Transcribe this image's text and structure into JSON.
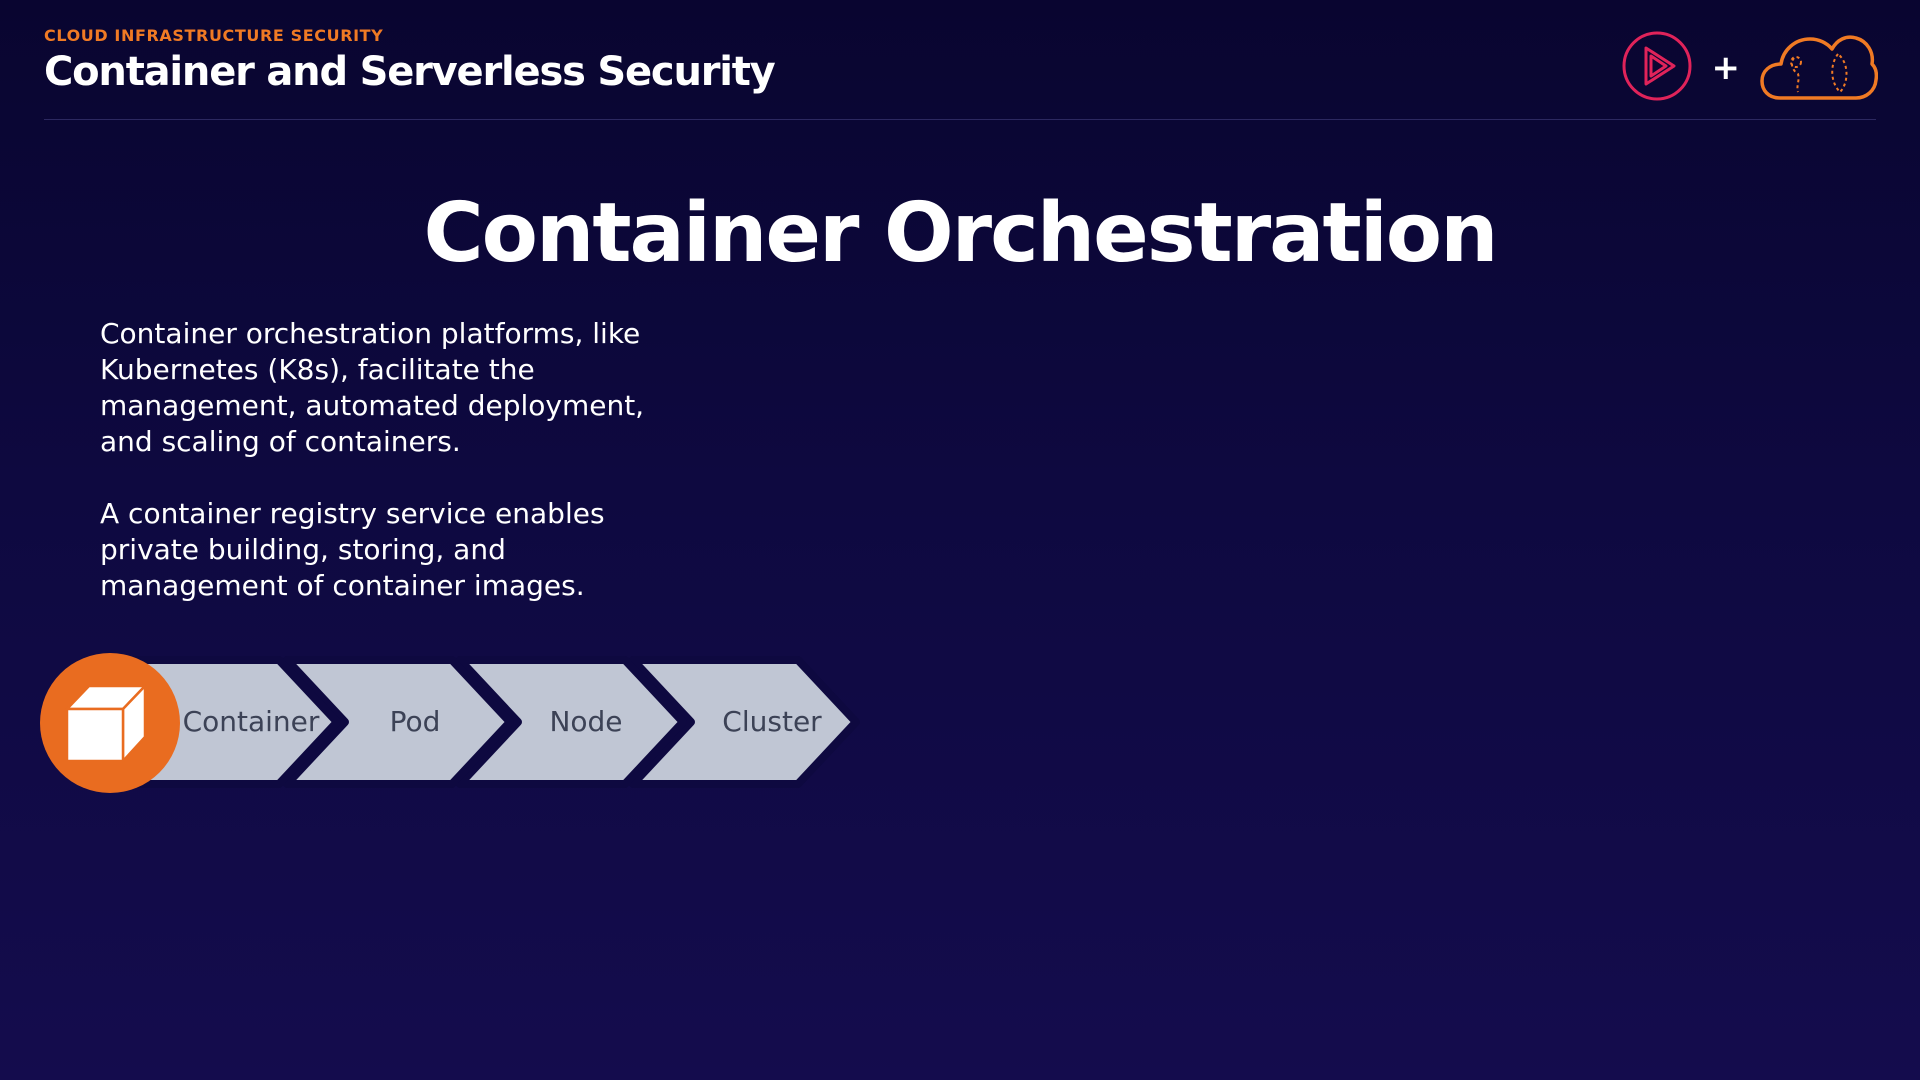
{
  "header": {
    "course_label": "CLOUD INFRASTRUCTURE SECURITY",
    "module_title": "Container and Serverless Security",
    "brand": {
      "play_logo_icon": "play-logo-icon",
      "plus": "+",
      "cloud_logo_icon": "cloud-logo-icon"
    }
  },
  "slide": {
    "title": "Container Orchestration",
    "paragraphs": [
      "Container orchestration platforms, like Kubernetes (K8s), facilitate the management, automated deployment, and scaling of containers.",
      "A container registry service enables private building, storing, and management of container images."
    ],
    "hierarchy": {
      "icon": "container-cube-icon",
      "steps": [
        "Container",
        "Pod",
        "Node",
        "Cluster"
      ]
    }
  },
  "colors": {
    "accent_orange": "#f07a24",
    "play_logo": "#e0235a",
    "chevron_fill": "#c0c6d4",
    "chevron_text": "#3c4256",
    "background_top": "#090530",
    "background_bottom": "#140c4d"
  }
}
